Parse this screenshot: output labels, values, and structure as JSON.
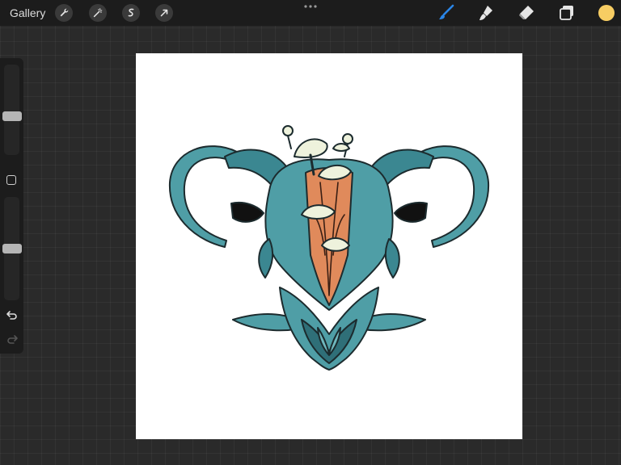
{
  "topbar": {
    "gallery_label": "Gallery",
    "left_tools": [
      "wrench-icon",
      "magic-wand-icon",
      "selection-icon",
      "transform-arrow-icon"
    ],
    "right_tools": [
      "brush-icon",
      "smudge-icon",
      "eraser-icon",
      "layers-icon"
    ],
    "active_tool": "brush-icon",
    "current_color": "#f7cd63"
  },
  "sidebar": {
    "brush_size_level": 0.42,
    "opacity_level": 0.5
  },
  "colors": {
    "accent": "#2a86e8",
    "teal": "#4f9ea6",
    "teal_dark": "#2f6f78",
    "orange": "#e08a5b",
    "cream": "#eef2dc"
  }
}
